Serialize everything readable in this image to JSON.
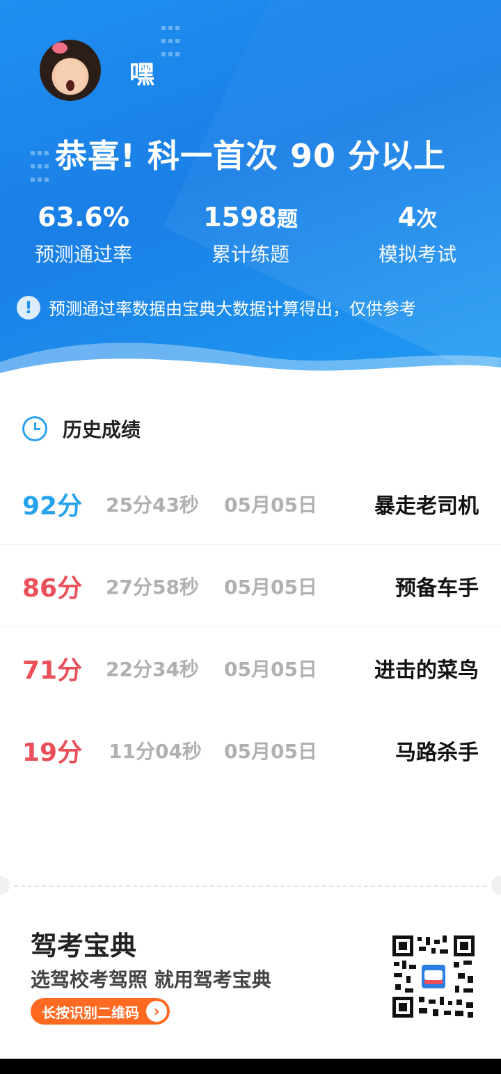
{
  "profile": {
    "username": "嘿"
  },
  "headline": "恭喜! 科一首次 90 分以上",
  "stats": [
    {
      "value": "63.6%",
      "unit": "",
      "label": "预测通过率"
    },
    {
      "value": "1598",
      "unit": "题",
      "label": "累计练题"
    },
    {
      "value": "4",
      "unit": "次",
      "label": "模拟考试"
    }
  ],
  "note": {
    "icon": "info-icon",
    "text": "预测通过率数据由宝典大数据计算得出，仅供参考"
  },
  "history": {
    "title": "历史成绩",
    "rows": [
      {
        "score": "92分",
        "duration": "25分43秒",
        "date": "05月05日",
        "title": "暴走老司机",
        "color": "#27a3ee"
      },
      {
        "score": "86分",
        "duration": "27分58秒",
        "date": "05月05日",
        "title": "预备车手",
        "color": "#e9505a"
      },
      {
        "score": "71分",
        "duration": "22分34秒",
        "date": "05月05日",
        "title": "进击的菜鸟",
        "color": "#e9505a"
      },
      {
        "score": "19分",
        "duration": "11分04秒",
        "date": "05月05日",
        "title": "马路杀手",
        "color": "#e9505a"
      }
    ]
  },
  "footer": {
    "brand": "驾考宝典",
    "slogan": "选驾校考驾照 就用驾考宝典",
    "qr_button_label": "长按识别二维码"
  },
  "colors": {
    "hero_blue": "#1a85ea",
    "accent_orange": "#ff6a22",
    "score_blue": "#27a3ee",
    "score_red": "#e9505a"
  }
}
